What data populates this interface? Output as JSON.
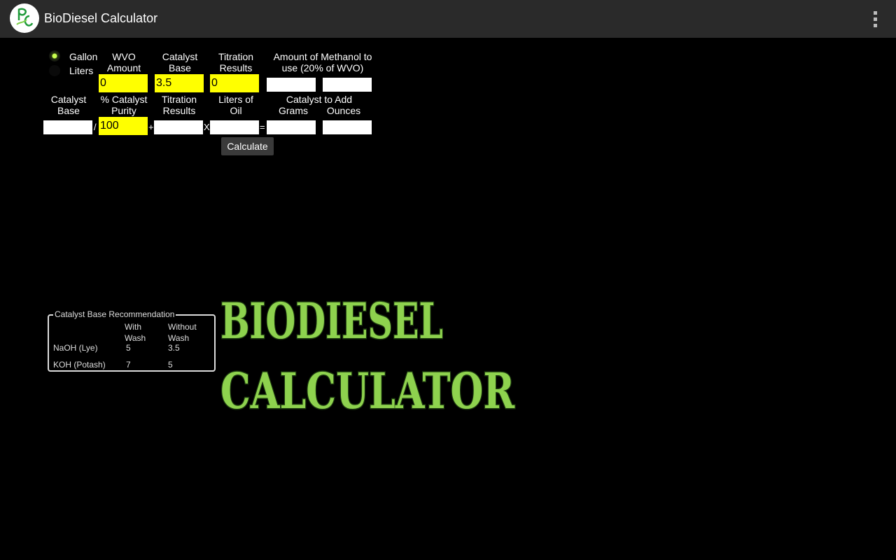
{
  "app": {
    "title": "BioDiesel Calculator"
  },
  "units": {
    "gallon_label": "Gallon",
    "liters_label": "Liters",
    "selected": "Gallon"
  },
  "row1": {
    "headers": {
      "wvo": "WVO Amount",
      "catalyst_base": "Catalyst Base",
      "titration": "Titration Results",
      "methanol": "Amount of Methanol to use (20% of WVO)"
    },
    "values": {
      "wvo": "0",
      "catalyst_base": "3.5",
      "titration": "0",
      "methanol_a": "",
      "methanol_b": ""
    }
  },
  "row2": {
    "headers": {
      "catalyst_base": "Catalyst Base",
      "purity": "% Catalyst Purity",
      "titration": "Titration Results",
      "liters_oil": "Liters of Oil",
      "catalyst_add": "Catalyst to Add",
      "grams": "Grams",
      "ounces": "Ounces"
    },
    "operators": {
      "divide": "/",
      "plus": "+",
      "times": "X",
      "equals": "="
    },
    "values": {
      "catalyst_base": "",
      "purity": "100",
      "titration": "",
      "liters_oil": "",
      "grams": "",
      "ounces": ""
    }
  },
  "actions": {
    "calculate": "Calculate"
  },
  "recommendation": {
    "title": "Catalyst Base Recommendation",
    "col_with": "With Wash",
    "col_without": "Without Wash",
    "rows": [
      {
        "name": "NaOH (Lye)",
        "with": "5",
        "without": "3.5"
      },
      {
        "name": "KOH (Potash)",
        "with": "7",
        "without": "5"
      }
    ]
  },
  "logo": {
    "line1": "BIODIESEL",
    "line2": "CALCULATOR"
  },
  "colors": {
    "accent_green": "#8ed24e",
    "field_yellow": "#ffff00",
    "actionbar": "#2a2a2a"
  },
  "icons": {
    "app": "bc-leaf-logo-icon",
    "overflow": "overflow-menu-icon"
  }
}
